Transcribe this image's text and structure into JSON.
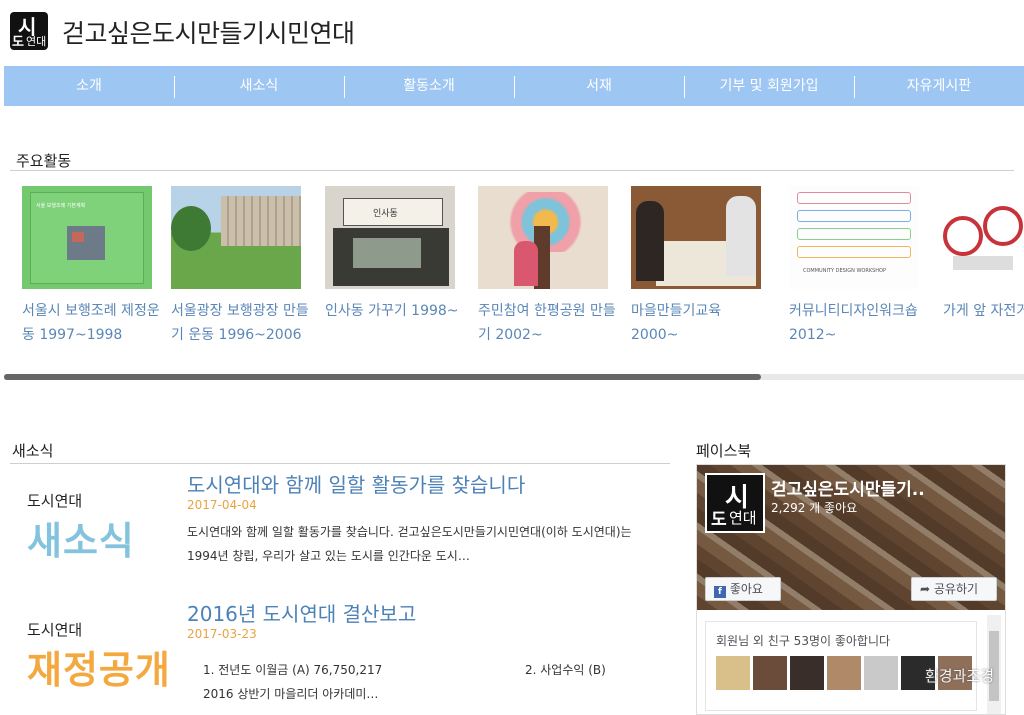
{
  "header": {
    "logo_text_top": "시",
    "logo_text_left": "도",
    "logo_text_right": "연대",
    "title": "걷고싶은도시만들기시민연대"
  },
  "nav": {
    "items": [
      "소개",
      "새소식",
      "활동소개",
      "서재",
      "기부 및 회원가입",
      "자유게시판"
    ],
    "background": "#9ec6f3"
  },
  "activities": {
    "heading": "주요활동",
    "cards": [
      {
        "label": "서울시 보행조례 제정운동 1997~1998"
      },
      {
        "label": "서울광장 보행광장 만들기 운동 1996~2006"
      },
      {
        "label": "인사동 가꾸기 1998~"
      },
      {
        "label": "주민참여 한평공원 만들기 2002~"
      },
      {
        "label": "마을만들기교육 2000~"
      },
      {
        "label": "커뮤니티디자인워크숍 2012~"
      },
      {
        "label": "가게 앞 자전거"
      }
    ],
    "thumb_text": {
      "green": "서울 보행조례 기본계획",
      "shop": "인사동",
      "design": "COMMUNITY DESIGN WORKSHOP"
    }
  },
  "news": {
    "heading": "새소식",
    "items": [
      {
        "thumb_org": "도시연대",
        "thumb_big": "새소식",
        "title": "도시연대와 함께 일할 활동가를 찾습니다",
        "date": "2017-04-04",
        "excerpt": "도시연대와 함께 일할 활동가를 찾습니다.   걷고싶은도시만들기시민연대(이하 도시연대)는 1994년 창립, 우리가 살고 있는 도시를 인간다운 도시…"
      },
      {
        "thumb_org": "도시연대",
        "thumb_big": "재정공개",
        "title": "2016년 도시연대 결산보고",
        "date": "2017-03-23",
        "line1": "1. 전년도 이월금 (A) 76,750,217",
        "line2": "2. 사업수익 (B)",
        "line3": "2016 상반기 마을리더 아카데미…"
      }
    ]
  },
  "facebook": {
    "heading": "페이스북",
    "page_name": "걷고싶은도시만들기..",
    "likes": "2,292 개 좋아요",
    "like_button": "좋아요",
    "share_button": "공유하기",
    "friends_text": "회원님 외 친구 53명이 좋아합니다",
    "avatar_colors": [
      "#d9c08a",
      "#6b4b3a",
      "#3a2e2a",
      "#b08a68",
      "#c9c9c9",
      "#2b2b2b",
      "#8e6f5a"
    ]
  },
  "watermark": "환경과조경"
}
